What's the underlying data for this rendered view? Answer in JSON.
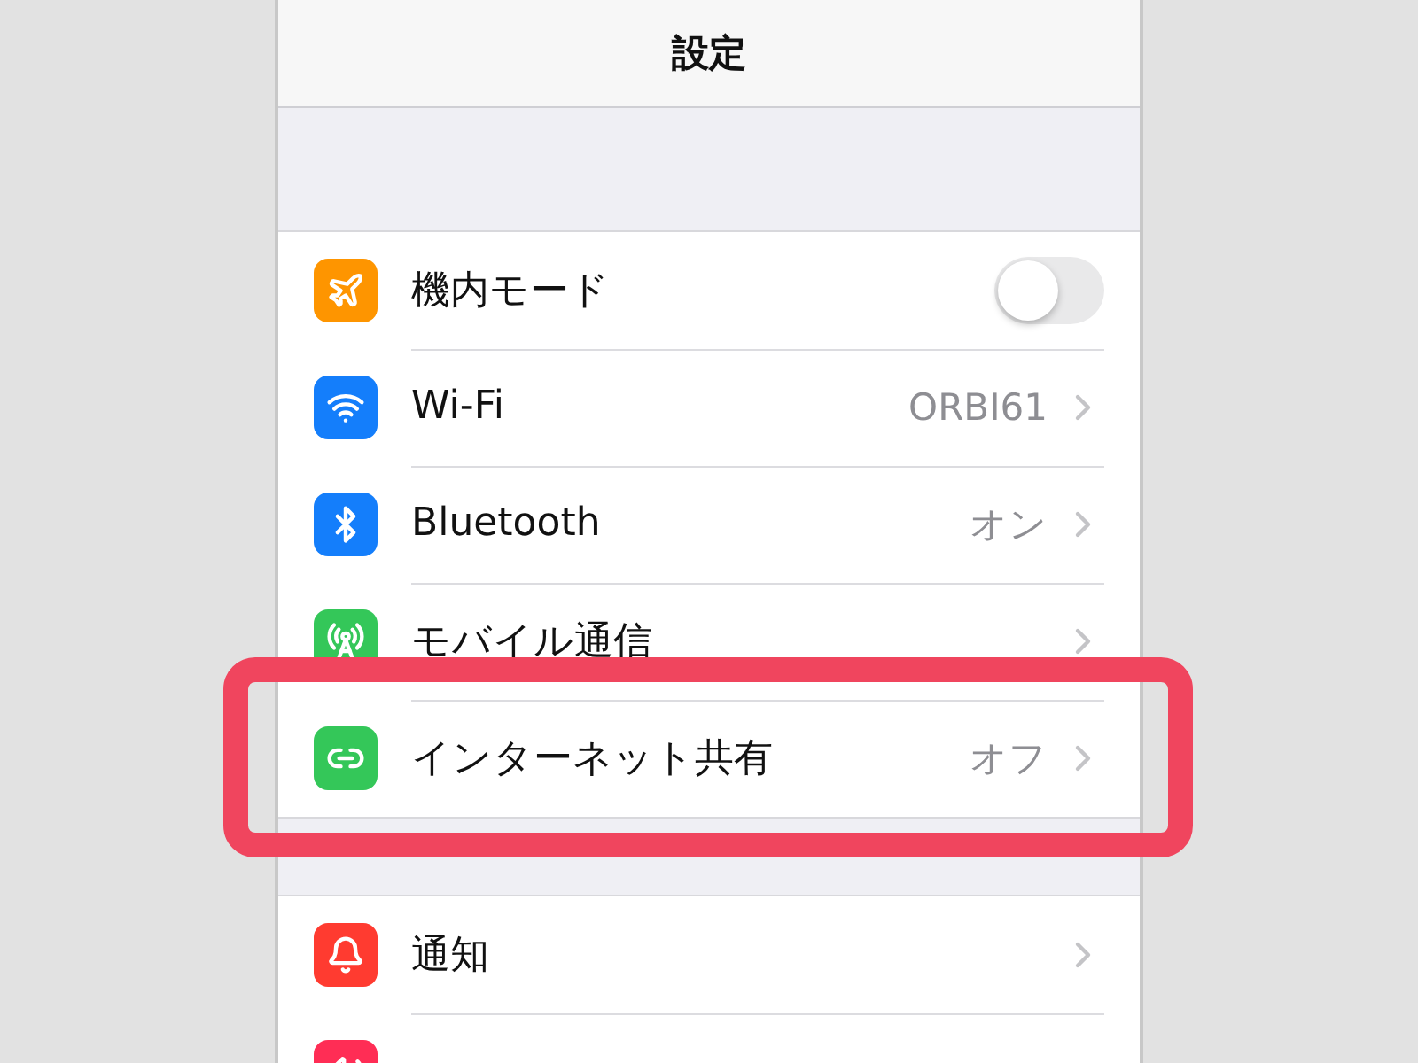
{
  "header": {
    "title": "設定"
  },
  "sections": [
    {
      "rows": [
        {
          "kind": "toggle",
          "color": "#fe9500",
          "label": "機内モード",
          "on": false,
          "highlighted": false
        },
        {
          "kind": "link",
          "color": "#147efb",
          "label": "Wi-Fi",
          "value": "ORBI61",
          "highlighted": false
        },
        {
          "kind": "link",
          "color": "#147efb",
          "label": "Bluetooth",
          "value": "オン",
          "highlighted": false
        },
        {
          "kind": "link",
          "color": "#34c759",
          "label": "モバイル通信",
          "highlighted": false
        },
        {
          "kind": "link",
          "color": "#34c759",
          "label": "インターネット共有",
          "value": "オフ",
          "highlighted": true
        }
      ]
    },
    {
      "rows": [
        {
          "kind": "link",
          "color": "#ff3b30",
          "label": "通知",
          "highlighted": false
        },
        {
          "kind": "partial",
          "color": "#ff2d55",
          "highlighted": false
        }
      ]
    }
  ]
}
